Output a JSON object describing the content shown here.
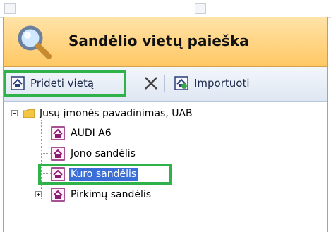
{
  "header": {
    "title": "Sandėlio vietų paieška",
    "icon": "magnifier-icon"
  },
  "toolbar": {
    "add_label": "Prideti vietą",
    "delete_icon": "close-icon",
    "import_label": "Importuoti"
  },
  "tree": {
    "root": "Jūsų įmonės pavadinimas, UAB",
    "items": [
      {
        "label": "AUDI A6"
      },
      {
        "label": "Jono sandėlis"
      },
      {
        "label": "Kuro sandėlis",
        "selected": true
      },
      {
        "label": "Pirkimų sandėlis",
        "collapsed": true
      }
    ]
  },
  "colors": {
    "highlight": "#2fb24a",
    "selection": "#3a6fd8",
    "header_bg": "#ffd17a"
  }
}
